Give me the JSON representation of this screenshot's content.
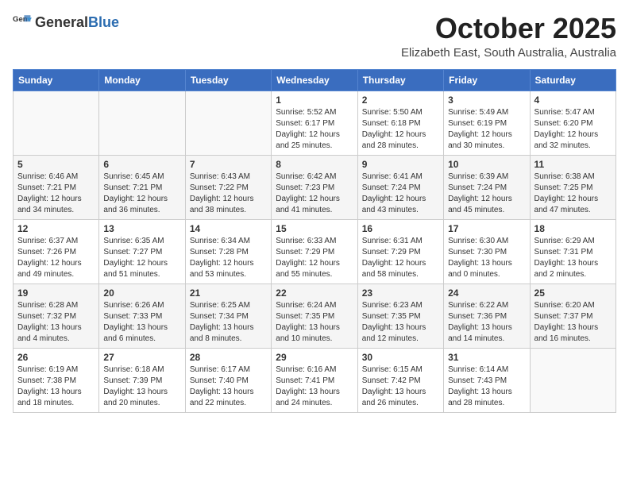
{
  "header": {
    "logo_general": "General",
    "logo_blue": "Blue",
    "month": "October 2025",
    "location": "Elizabeth East, South Australia, Australia"
  },
  "days_of_week": [
    "Sunday",
    "Monday",
    "Tuesday",
    "Wednesday",
    "Thursday",
    "Friday",
    "Saturday"
  ],
  "weeks": [
    [
      {
        "day": "",
        "text": ""
      },
      {
        "day": "",
        "text": ""
      },
      {
        "day": "",
        "text": ""
      },
      {
        "day": "1",
        "text": "Sunrise: 5:52 AM\nSunset: 6:17 PM\nDaylight: 12 hours\nand 25 minutes."
      },
      {
        "day": "2",
        "text": "Sunrise: 5:50 AM\nSunset: 6:18 PM\nDaylight: 12 hours\nand 28 minutes."
      },
      {
        "day": "3",
        "text": "Sunrise: 5:49 AM\nSunset: 6:19 PM\nDaylight: 12 hours\nand 30 minutes."
      },
      {
        "day": "4",
        "text": "Sunrise: 5:47 AM\nSunset: 6:20 PM\nDaylight: 12 hours\nand 32 minutes."
      }
    ],
    [
      {
        "day": "5",
        "text": "Sunrise: 6:46 AM\nSunset: 7:21 PM\nDaylight: 12 hours\nand 34 minutes."
      },
      {
        "day": "6",
        "text": "Sunrise: 6:45 AM\nSunset: 7:21 PM\nDaylight: 12 hours\nand 36 minutes."
      },
      {
        "day": "7",
        "text": "Sunrise: 6:43 AM\nSunset: 7:22 PM\nDaylight: 12 hours\nand 38 minutes."
      },
      {
        "day": "8",
        "text": "Sunrise: 6:42 AM\nSunset: 7:23 PM\nDaylight: 12 hours\nand 41 minutes."
      },
      {
        "day": "9",
        "text": "Sunrise: 6:41 AM\nSunset: 7:24 PM\nDaylight: 12 hours\nand 43 minutes."
      },
      {
        "day": "10",
        "text": "Sunrise: 6:39 AM\nSunset: 7:24 PM\nDaylight: 12 hours\nand 45 minutes."
      },
      {
        "day": "11",
        "text": "Sunrise: 6:38 AM\nSunset: 7:25 PM\nDaylight: 12 hours\nand 47 minutes."
      }
    ],
    [
      {
        "day": "12",
        "text": "Sunrise: 6:37 AM\nSunset: 7:26 PM\nDaylight: 12 hours\nand 49 minutes."
      },
      {
        "day": "13",
        "text": "Sunrise: 6:35 AM\nSunset: 7:27 PM\nDaylight: 12 hours\nand 51 minutes."
      },
      {
        "day": "14",
        "text": "Sunrise: 6:34 AM\nSunset: 7:28 PM\nDaylight: 12 hours\nand 53 minutes."
      },
      {
        "day": "15",
        "text": "Sunrise: 6:33 AM\nSunset: 7:29 PM\nDaylight: 12 hours\nand 55 minutes."
      },
      {
        "day": "16",
        "text": "Sunrise: 6:31 AM\nSunset: 7:29 PM\nDaylight: 12 hours\nand 58 minutes."
      },
      {
        "day": "17",
        "text": "Sunrise: 6:30 AM\nSunset: 7:30 PM\nDaylight: 13 hours\nand 0 minutes."
      },
      {
        "day": "18",
        "text": "Sunrise: 6:29 AM\nSunset: 7:31 PM\nDaylight: 13 hours\nand 2 minutes."
      }
    ],
    [
      {
        "day": "19",
        "text": "Sunrise: 6:28 AM\nSunset: 7:32 PM\nDaylight: 13 hours\nand 4 minutes."
      },
      {
        "day": "20",
        "text": "Sunrise: 6:26 AM\nSunset: 7:33 PM\nDaylight: 13 hours\nand 6 minutes."
      },
      {
        "day": "21",
        "text": "Sunrise: 6:25 AM\nSunset: 7:34 PM\nDaylight: 13 hours\nand 8 minutes."
      },
      {
        "day": "22",
        "text": "Sunrise: 6:24 AM\nSunset: 7:35 PM\nDaylight: 13 hours\nand 10 minutes."
      },
      {
        "day": "23",
        "text": "Sunrise: 6:23 AM\nSunset: 7:35 PM\nDaylight: 13 hours\nand 12 minutes."
      },
      {
        "day": "24",
        "text": "Sunrise: 6:22 AM\nSunset: 7:36 PM\nDaylight: 13 hours\nand 14 minutes."
      },
      {
        "day": "25",
        "text": "Sunrise: 6:20 AM\nSunset: 7:37 PM\nDaylight: 13 hours\nand 16 minutes."
      }
    ],
    [
      {
        "day": "26",
        "text": "Sunrise: 6:19 AM\nSunset: 7:38 PM\nDaylight: 13 hours\nand 18 minutes."
      },
      {
        "day": "27",
        "text": "Sunrise: 6:18 AM\nSunset: 7:39 PM\nDaylight: 13 hours\nand 20 minutes."
      },
      {
        "day": "28",
        "text": "Sunrise: 6:17 AM\nSunset: 7:40 PM\nDaylight: 13 hours\nand 22 minutes."
      },
      {
        "day": "29",
        "text": "Sunrise: 6:16 AM\nSunset: 7:41 PM\nDaylight: 13 hours\nand 24 minutes."
      },
      {
        "day": "30",
        "text": "Sunrise: 6:15 AM\nSunset: 7:42 PM\nDaylight: 13 hours\nand 26 minutes."
      },
      {
        "day": "31",
        "text": "Sunrise: 6:14 AM\nSunset: 7:43 PM\nDaylight: 13 hours\nand 28 minutes."
      },
      {
        "day": "",
        "text": ""
      }
    ]
  ]
}
